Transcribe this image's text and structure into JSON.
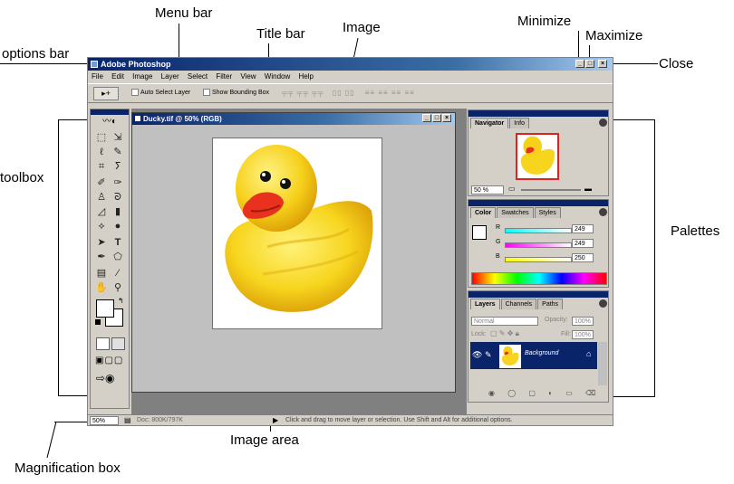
{
  "callouts": {
    "menu_bar": "Menu bar",
    "title_bar": "Title bar",
    "image": "Image",
    "options_bar": "options bar",
    "minimize": "Minimize",
    "maximize": "Maximize",
    "close": "Close",
    "toolbox": "toolbox",
    "palettes": "Palettes",
    "image_area": "Image area",
    "magnification_box": "Magnification box"
  },
  "app": {
    "title": "Adobe Photoshop",
    "menu": [
      "File",
      "Edit",
      "Image",
      "Layer",
      "Select",
      "Filter",
      "View",
      "Window",
      "Help"
    ],
    "options": {
      "auto_select": "Auto Select Layer",
      "show_bounding": "Show Bounding Box"
    }
  },
  "document": {
    "title": "Ducky.tif @ 50% (RGB)"
  },
  "navigator": {
    "tabs": [
      "Navigator",
      "Info"
    ],
    "zoom": "50 %"
  },
  "color": {
    "tabs": [
      "Color",
      "Swatches",
      "Styles"
    ],
    "r_label": "R",
    "g_label": "G",
    "b_label": "B",
    "r": "249",
    "g": "249",
    "b": "250"
  },
  "layers": {
    "tabs": [
      "Layers",
      "Channels",
      "Paths"
    ],
    "blend_mode": "Normal",
    "opacity_label": "Opacity:",
    "opacity": "100%",
    "lock_label": "Lock:",
    "fill_label": "Fill:",
    "fill": "100%",
    "layer_name": "Background"
  },
  "status": {
    "zoom": "50%",
    "doc_size": "Doc: 800K/797K",
    "hint": "Click and drag to move layer or selection. Use Shift and Alt for additional options."
  },
  "colors": {
    "titlebar": "#0a246a",
    "chrome": "#d4d0c8",
    "duck_body": "#f7d51e",
    "duck_beak": "#e8321d"
  }
}
